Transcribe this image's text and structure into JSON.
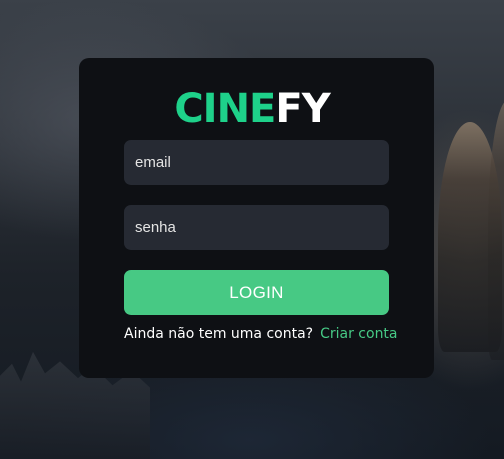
{
  "logo": {
    "accent": "CINE",
    "rest": "FY"
  },
  "form": {
    "email_placeholder": "email",
    "password_placeholder": "senha",
    "login_label": "LOGIN"
  },
  "signup": {
    "question": "Ainda não tem uma conta?",
    "link_label": "Criar conta"
  },
  "colors": {
    "brand_green": "#1ed18a",
    "button_green": "#47c984",
    "card_bg": "#0e1014",
    "field_bg": "#262a33"
  }
}
